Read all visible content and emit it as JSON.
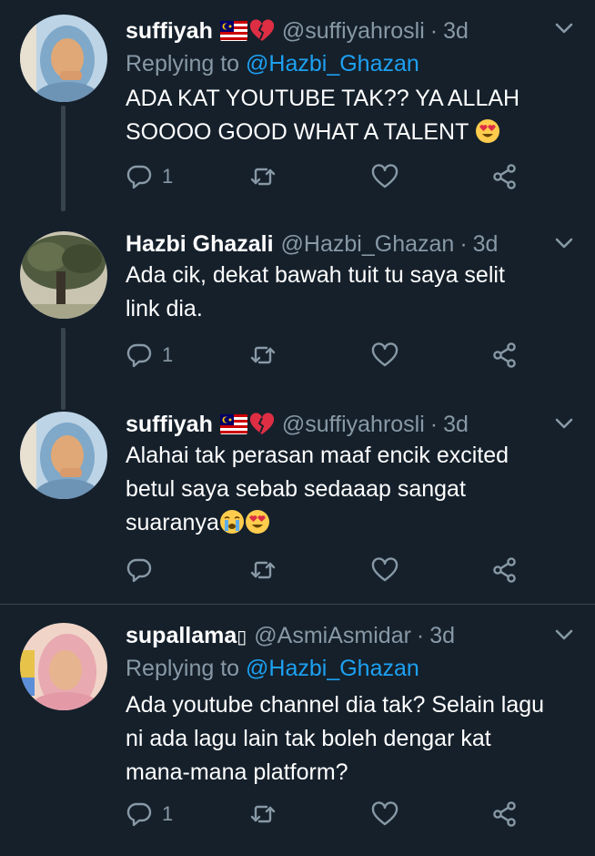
{
  "tweets": [
    {
      "name": "suffiyah",
      "handle": "@suffiyahrosli",
      "time": "3d",
      "replying_label": "Replying to",
      "replying_to": "@Hazbi_Ghazan",
      "text_lines": [
        "ADA KAT YOUTUBE TAK?? YA ALLAH",
        "SOOOO GOOD WHAT A TALENT"
      ],
      "reply_count": "1",
      "emoji_after_name": [
        "malaysia-flag",
        "broken-heart"
      ],
      "emoji_in_text": [
        "heart-eyes"
      ]
    },
    {
      "name": "Hazbi Ghazali",
      "handle": "@Hazbi_Ghazan",
      "time": "3d",
      "text_lines": [
        "Ada cik, dekat bawah tuit tu saya selit",
        "link dia."
      ],
      "reply_count": "1"
    },
    {
      "name": "suffiyah",
      "handle": "@suffiyahrosli",
      "time": "3d",
      "text_lines": [
        "Alahai tak perasan maaf encik excited",
        "betul saya sebab sedaaap sangat",
        "suaranya"
      ],
      "reply_count": "",
      "emoji_after_name": [
        "malaysia-flag",
        "broken-heart"
      ],
      "emoji_in_text": [
        "crying-face",
        "heart-eyes"
      ]
    },
    {
      "name": "supallama",
      "name_suffix": "▯",
      "handle": "@AsmiAsmidar",
      "time": "3d",
      "replying_label": "Replying to",
      "replying_to": "@Hazbi_Ghazan",
      "text_lines": [
        "Ada youtube channel dia tak? Selain lagu",
        "ni ada lagu lain tak boleh dengar kat",
        "mana-mana platform?"
      ],
      "reply_count": "1"
    }
  ],
  "colors": {
    "background": "#15202b",
    "secondary_text": "#8899a6",
    "link": "#1da1f2",
    "divider": "#38444d"
  },
  "icons": [
    "reply-icon",
    "retweet-icon",
    "like-icon",
    "share-icon",
    "chevron-down-icon"
  ]
}
